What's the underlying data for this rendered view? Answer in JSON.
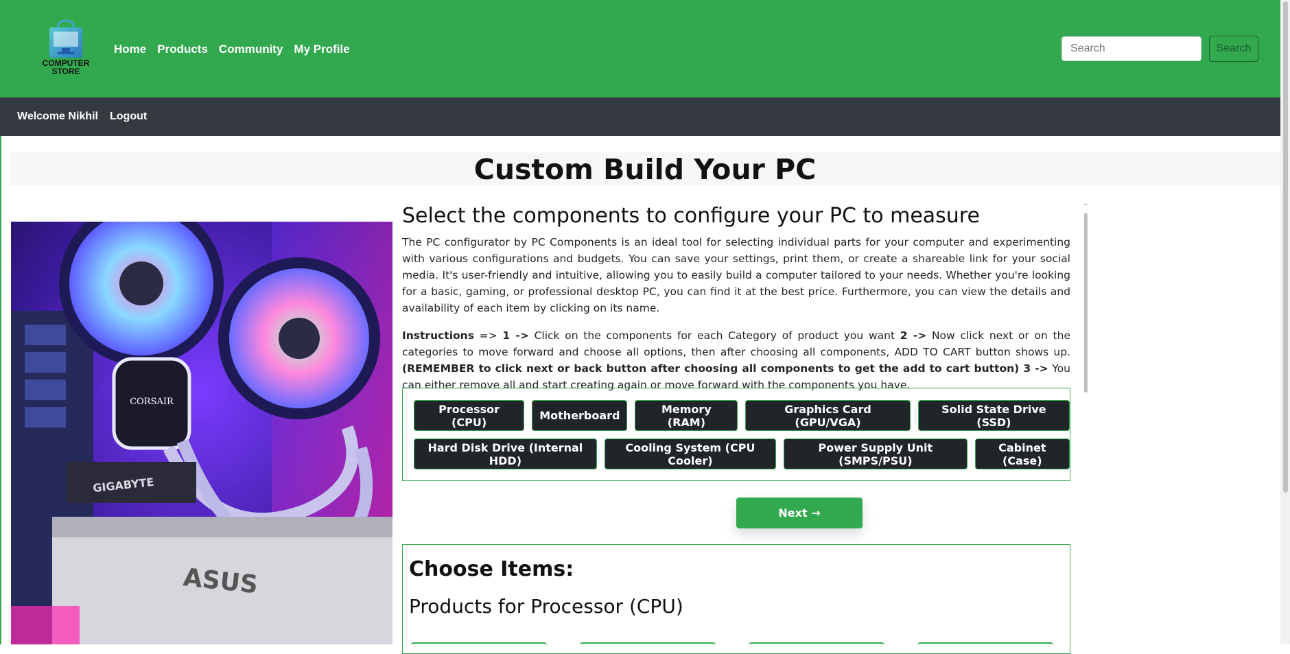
{
  "brand": {
    "logo_text_line1": "COMPUTER",
    "logo_text_line2": "STORE"
  },
  "nav": {
    "items": [
      "Home",
      "Products",
      "Community",
      "My Profile"
    ]
  },
  "search": {
    "placeholder": "Search",
    "button_label": "Search"
  },
  "subnav": {
    "welcome": "Welcome Nikhil",
    "logout": "Logout"
  },
  "page": {
    "title": "Custom Build Your PC"
  },
  "intro": {
    "heading": "Select the components to configure your PC to measure",
    "paragraph": "The PC configurator by PC Components is an ideal tool for selecting individual parts for your computer and experimenting with various configurations and budgets. You can save your settings, print them, or create a shareable link for your social media. It's user-friendly and intuitive, allowing you to easily build a computer tailored to your needs. Whether you're looking for a basic, gaming, or professional desktop PC, you can find it at the best price. Furthermore, you can view the details and availability of each item by clicking on its name.",
    "instructions_label": "Instructions",
    "instructions_arrow": " => ",
    "step1_num": "1 ->",
    "step1_text": " Click on the components for each Category of product you want ",
    "step2_num": "2 ->",
    "step2_text": " Now click next or on the categories to move forward and choose all options, then after choosing all components, ADD TO CART button shows up. ",
    "step2_bold": "(REMEMBER to click next or back button after choosing all components to get the add to cart button)",
    "step3_num": " 3 ->",
    "step3_text": " You can either remove all and start creating again or move forward with the components you have."
  },
  "categories": {
    "row1": [
      "Processor (CPU)",
      "Motherboard",
      "Memory (RAM)",
      "Graphics Card (GPU/VGA)",
      "Solid State Drive (SSD)"
    ],
    "row2": [
      "Hard Disk Drive (Internal HDD)",
      "Cooling System (CPU Cooler)",
      "Power Supply Unit (SMPS/PSU)",
      "Cabinet (Case)"
    ]
  },
  "next_button": {
    "label": "Next",
    "icon": "arrow-right-icon"
  },
  "items": {
    "title": "Choose Items:",
    "subtitle": "Products for Processor (CPU)"
  },
  "hero_image": {
    "overlay_texts": [
      "CORSAIR",
      "GIGABYTE",
      "ASUS"
    ]
  },
  "colors": {
    "primary_green": "#32a94e",
    "dark": "#343a40",
    "button_dark": "#212529"
  }
}
